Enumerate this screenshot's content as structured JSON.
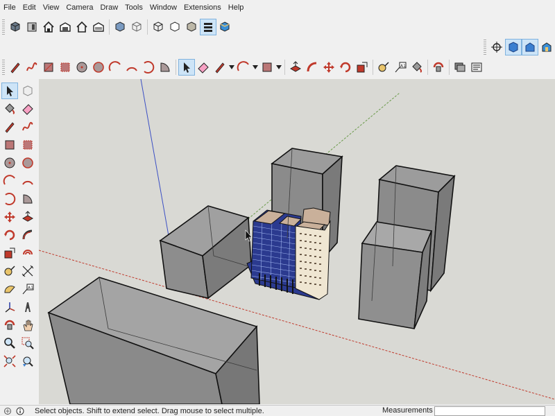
{
  "menu": {
    "items": [
      "File",
      "Edit",
      "View",
      "Camera",
      "Draw",
      "Tools",
      "Window",
      "Extensions",
      "Help"
    ]
  },
  "status": {
    "text": "Select objects. Shift to extend select. Drag mouse to select multiple.",
    "measurements_label": "Measurements",
    "measurements_value": ""
  },
  "colors": {
    "viewport_bg": "#d9d9d4",
    "axis_red": "#c0392b",
    "axis_green": "#6a9a4a",
    "axis_blue": "#3b4fc4",
    "massing_fill": "#8a8a8a",
    "glass_blue": "#2b3a8f",
    "facade_cream": "#efe6d2",
    "roof_tan": "#c9b09a",
    "active_tool": "#cde4f7"
  },
  "toolbars": {
    "views_icons": [
      "component-icon",
      "house-front-icon",
      "home-icon",
      "warehouse-icon",
      "house-outline-icon",
      "garage-icon",
      "iso-view-icon",
      "wireframe-view-icon",
      "xray-view-icon",
      "hidden-line-icon",
      "shaded-icon",
      "monochrome-icon",
      "textured-icon"
    ],
    "right_icons": [
      "position-camera-icon",
      "look-around-icon",
      "walk-icon",
      "section-icon"
    ],
    "main_icons": [
      "pencil-icon",
      "freehand-icon",
      "rectangle-icon",
      "rotated-rect-icon",
      "circle-icon",
      "polygon-icon",
      "arc-icon",
      "two-point-arc-icon",
      "three-point-arc-icon",
      "pie-icon",
      "select-icon",
      "eraser-icon",
      "pencil-line-icon",
      "arc-dropdown-icon",
      "rectangle-dropdown-icon",
      "push-pull-icon",
      "follow-me-icon",
      "move-icon",
      "rotate-icon",
      "scale-icon",
      "tape-measure-icon",
      "text-icon",
      "paint-bucket-icon",
      "orbit-icon",
      "layers-icon",
      "outliner-icon"
    ],
    "left_icons": [
      "select-icon",
      "component-icon",
      "paint-bucket-icon",
      "eraser-icon",
      "pencil-icon",
      "freehand-icon",
      "rectangle-icon",
      "rotated-rect-icon",
      "circle-icon",
      "polygon-icon",
      "arc-icon",
      "two-point-arc-icon",
      "three-point-arc-icon",
      "pie-icon",
      "move-icon",
      "push-pull-icon",
      "rotate-icon",
      "follow-me-icon",
      "scale-icon",
      "offset-icon",
      "tape-measure-icon",
      "dimension-icon",
      "protractor-icon",
      "text-icon",
      "axes-icon",
      "3d-text-icon",
      "orbit-icon",
      "pan-icon",
      "zoom-icon",
      "zoom-window-icon",
      "zoom-extents-icon",
      "previous-view-icon"
    ]
  }
}
